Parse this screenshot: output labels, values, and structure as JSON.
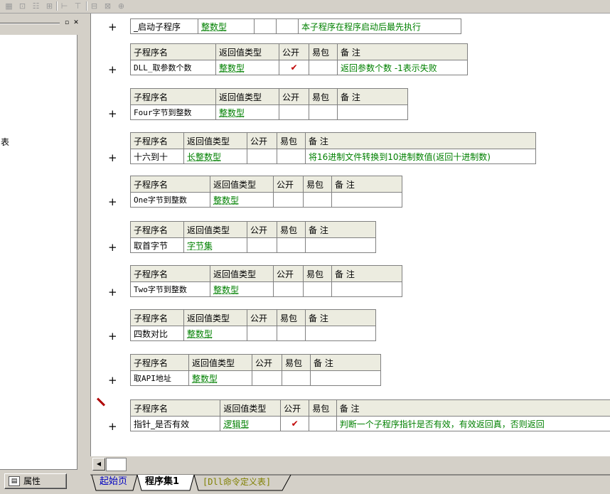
{
  "toolbar": {
    "icons": [
      "grid-icon",
      "table-icon",
      "align-icon",
      "split-icon",
      "width-icon",
      "height-icon",
      "fit-width-icon",
      "fit-height-icon",
      "center-icon"
    ]
  },
  "left_panel": {
    "partial_text": "表",
    "properties_button": "属性"
  },
  "subroutines": [
    {
      "headers": [
        "子程序名",
        "返回值类型",
        "公开",
        "易包",
        "备 注"
      ],
      "name": "_启动子程序",
      "return_type": "整数型",
      "public": "",
      "easy": "",
      "note": "本子程序在程序启动后最先执行",
      "no_header": true
    },
    {
      "headers": [
        "子程序名",
        "返回值类型",
        "公开",
        "易包",
        "备 注"
      ],
      "name": "DLL_取参数个数",
      "return_type": "整数型",
      "public": "✔",
      "easy": "",
      "note": "返回参数个数 -1表示失败"
    },
    {
      "headers": [
        "子程序名",
        "返回值类型",
        "公开",
        "易包",
        "备 注"
      ],
      "name": "Four字节到整数",
      "return_type": "整数型",
      "public": "",
      "easy": "",
      "note": ""
    },
    {
      "headers": [
        "子程序名",
        "返回值类型",
        "公开",
        "易包",
        "备 注"
      ],
      "name": "十六到十",
      "return_type": "长整数型",
      "public": "",
      "easy": "",
      "note": "将16进制文件转换到10进制数值(返回十进制数)"
    },
    {
      "headers": [
        "子程序名",
        "返回值类型",
        "公开",
        "易包",
        "备 注"
      ],
      "name": "One字节到整数",
      "return_type": "整数型",
      "public": "",
      "easy": "",
      "note": ""
    },
    {
      "headers": [
        "子程序名",
        "返回值类型",
        "公开",
        "易包",
        "备 注"
      ],
      "name": "取首字节",
      "return_type": "字节集",
      "public": "",
      "easy": "",
      "note": ""
    },
    {
      "headers": [
        "子程序名",
        "返回值类型",
        "公开",
        "易包",
        "备 注"
      ],
      "name": "Two字节到整数",
      "return_type": "整数型",
      "public": "",
      "easy": "",
      "note": ""
    },
    {
      "headers": [
        "子程序名",
        "返回值类型",
        "公开",
        "易包",
        "备 注"
      ],
      "name": "四数对比",
      "return_type": "整数型",
      "public": "",
      "easy": "",
      "note": ""
    },
    {
      "headers": [
        "子程序名",
        "返回值类型",
        "公开",
        "易包",
        "备 注"
      ],
      "name": "取API地址",
      "return_type": "整数型",
      "public": "",
      "easy": "",
      "note": ""
    },
    {
      "headers": [
        "子程序名",
        "返回值类型",
        "公开",
        "易包",
        "备 注"
      ],
      "name": "指针_是否有效",
      "return_type": "逻辑型",
      "public": "✔",
      "easy": "",
      "note": "判断一个子程序指针是否有效，有效返回真，否则返回"
    }
  ],
  "tabs": [
    "起始页",
    "程序集1",
    "[Dll命令定义表]"
  ],
  "colors": {
    "note_green": "#008000",
    "header_bg": "#ecece0",
    "check_red": "#c00000"
  }
}
